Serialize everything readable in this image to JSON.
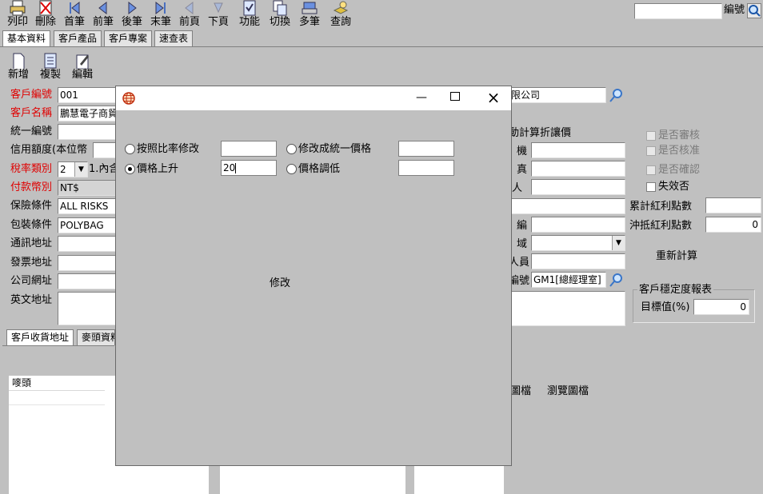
{
  "toolbar": {
    "print": "列印",
    "delete": "刪除",
    "first": "首筆",
    "prev": "前筆",
    "next": "後筆",
    "last": "末筆",
    "prev_page": "前頁",
    "next_page": "下頁",
    "function": "功能",
    "switch": "切換",
    "multi": "多筆",
    "query": "查詢",
    "code_label": "編號"
  },
  "tabs": [
    "基本資料",
    "客戶產品",
    "客戶專案",
    "速查表"
  ],
  "sub_toolbar": {
    "new": "新增",
    "copy": "複製",
    "edit": "編輯"
  },
  "left_fields": [
    {
      "label": "客戶編號",
      "value": "001",
      "required": true
    },
    {
      "label": "客戶名稱",
      "value": "鵬慧電子商貿",
      "required": true
    },
    {
      "label": "統一編號",
      "value": "",
      "required": false
    },
    {
      "label": "信用額度(本位幣",
      "value": "",
      "required": false
    },
    {
      "label": "稅率類別",
      "value": "2",
      "extra": "1.內含",
      "required": true
    },
    {
      "label": "付款幣別",
      "value": "NT$",
      "required": true
    },
    {
      "label": "保險條件",
      "value": "ALL RISKS",
      "required": false
    },
    {
      "label": "包裝條件",
      "value": "POLYBAG",
      "required": false
    },
    {
      "label": "通訊地址",
      "value": "",
      "required": false
    },
    {
      "label": "發票地址",
      "value": "",
      "required": false
    },
    {
      "label": "公司網址",
      "value": "",
      "required": false
    },
    {
      "label": "英文地址",
      "value": "",
      "required": false
    }
  ],
  "right_top": {
    "company_suffix": "限公司",
    "auto_calc": "動計算折讓價",
    "label_machine": "機",
    "label_fax": "真",
    "label_person": "人",
    "label_code": "編",
    "label_area": "域",
    "label_staff": "人員",
    "label_num": "編號",
    "staff_code": "GM1[總經理室]"
  },
  "checks": {
    "audit": "是否審核",
    "approve": "是否核准",
    "confirm": "是否確認",
    "invalid": "失效否"
  },
  "bonus": {
    "accum": "累計紅利點數",
    "offset": "沖抵紅利點數",
    "offset_value": "0",
    "recalc": "重新計算"
  },
  "stability": {
    "title": "客戶穩定度報表",
    "target_label": "目標值(%)",
    "target_value": "0"
  },
  "bottom_tabs": {
    "ship_addr": "客戶收貨地址",
    "mark": "麥頭資料"
  },
  "bottom_grid": {
    "header": "嘜頭"
  },
  "image_labels": {
    "image": "圖檔",
    "browse": "瀏覽圖檔"
  },
  "dialog": {
    "ratio_label": "按照比率修改",
    "unify_label": "修改成統一價格",
    "raise_label": "價格上升",
    "lower_label": "價格調低",
    "raise_value": "20",
    "modify_button": "修改"
  }
}
